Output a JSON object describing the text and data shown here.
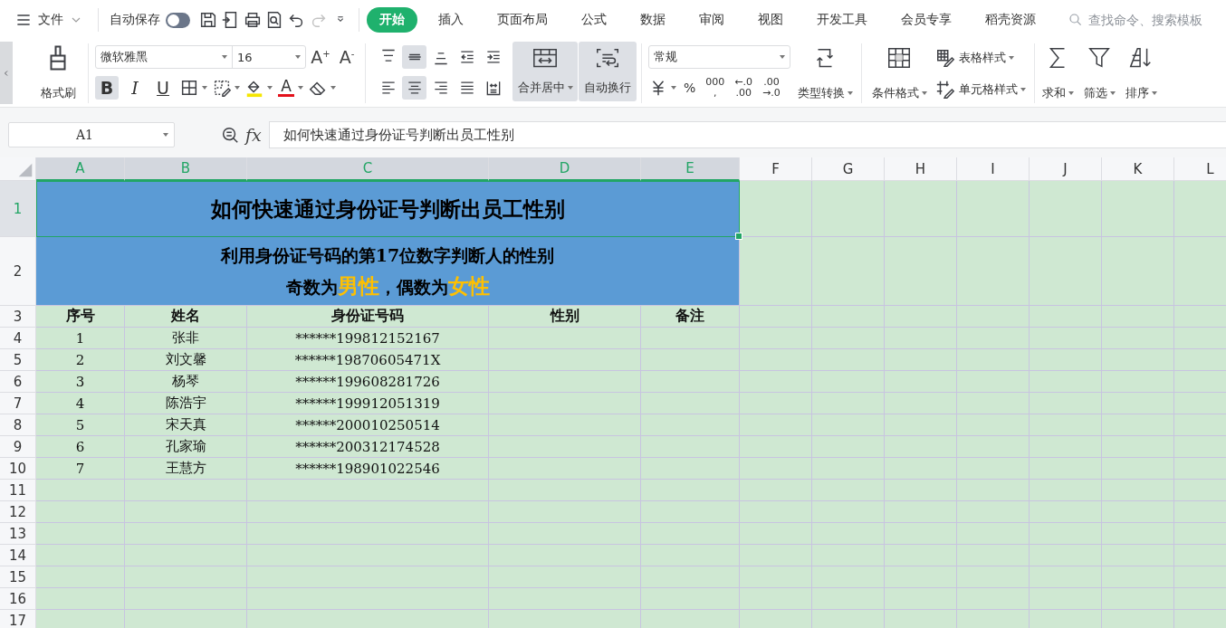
{
  "menu_bar": {
    "file_menu": "文件",
    "autosave": {
      "label": "自动保存",
      "on": false
    },
    "quick_access": [
      {
        "kind": "save",
        "disabled": false
      },
      {
        "kind": "export",
        "disabled": false
      },
      {
        "kind": "print",
        "disabled": false
      },
      {
        "kind": "preview",
        "disabled": false
      },
      {
        "kind": "undo",
        "disabled": false
      },
      {
        "kind": "redo",
        "disabled": true
      },
      {
        "kind": "more",
        "disabled": false
      }
    ],
    "tabs": [
      {
        "label": "开始",
        "selected": true
      },
      {
        "label": "插入",
        "selected": false
      },
      {
        "label": "页面布局",
        "selected": false
      },
      {
        "label": "公式",
        "selected": false
      },
      {
        "label": "数据",
        "selected": false
      },
      {
        "label": "审阅",
        "selected": false
      },
      {
        "label": "视图",
        "selected": false
      },
      {
        "label": "开发工具",
        "selected": false
      },
      {
        "label": "会员专享",
        "selected": false
      },
      {
        "label": "稻壳资源",
        "selected": false
      }
    ],
    "search": {
      "placeholder": "查找命令、搜索模板"
    }
  },
  "ribbon": {
    "format_painter": "格式刷",
    "font": {
      "name": "微软雅黑",
      "size": "16",
      "size_buttons": [
        "A$^{+}$",
        "A$^{-}$"
      ]
    },
    "font_styles": [
      {
        "kind": "bold",
        "label": "B",
        "selected": true
      },
      {
        "kind": "italic",
        "label": "I",
        "selected": false
      },
      {
        "kind": "underline",
        "label": "U",
        "selected": false
      }
    ],
    "font_tools": [
      {
        "kind": "borders"
      },
      {
        "kind": "cell-format"
      },
      {
        "kind": "fill-color"
      },
      {
        "kind": "font-color",
        "label": "A"
      },
      {
        "kind": "clear"
      }
    ],
    "align_rows": [
      [
        {
          "kind": "top",
          "selected": false
        },
        {
          "kind": "middle",
          "selected": true
        },
        {
          "kind": "bottom",
          "selected": false
        },
        {
          "kind": "outdent",
          "selected": false
        },
        {
          "kind": "indent",
          "selected": false
        }
      ],
      [
        {
          "kind": "left",
          "selected": false
        },
        {
          "kind": "center",
          "selected": true
        },
        {
          "kind": "right",
          "selected": false
        },
        {
          "kind": "justify",
          "selected": false
        },
        {
          "kind": "distributed",
          "selected": false
        }
      ]
    ],
    "merge": {
      "label": "合并居中",
      "selected": true
    },
    "wrap": {
      "label": "自动换行",
      "selected": true
    },
    "number_format": "常规",
    "number_tools": [
      {
        "kind": "currency"
      },
      {
        "kind": "text",
        "lines": [
          "%"
        ]
      },
      {
        "kind": "text",
        "lines": [
          "000",
          ","
        ]
      },
      {
        "kind": "text",
        "lines": [
          "←.0",
          ".00"
        ]
      },
      {
        "kind": "text",
        "lines": [
          ".00",
          "→.0"
        ]
      }
    ],
    "convert": "类型转换",
    "conditional_format": "条件格式",
    "table_style": "表格样式",
    "cell_style": "单元格样式",
    "editing": [
      {
        "kind": "sum",
        "label": "求和"
      },
      {
        "kind": "filter",
        "label": "筛选"
      },
      {
        "kind": "sort",
        "label": "排序"
      }
    ]
  },
  "formula_bar": {
    "name_box": "A1",
    "fx": "fx",
    "formula": "如何快速通过身份证号判断出员工性别"
  },
  "sheet": {
    "columns": [
      {
        "label": "A",
        "selected": true
      },
      {
        "label": "B",
        "selected": true
      },
      {
        "label": "C",
        "selected": true
      },
      {
        "label": "D",
        "selected": true
      },
      {
        "label": "E",
        "selected": true
      },
      {
        "label": "F",
        "selected": false
      },
      {
        "label": "G",
        "selected": false
      },
      {
        "label": "H",
        "selected": false
      },
      {
        "label": "I",
        "selected": false
      },
      {
        "label": "J",
        "selected": false
      },
      {
        "label": "K",
        "selected": false
      },
      {
        "label": "L",
        "selected": false
      }
    ],
    "rows": [
      {
        "label": "1",
        "selected": true
      },
      {
        "label": "2",
        "selected": false
      },
      {
        "label": "3",
        "selected": false
      },
      {
        "label": "4",
        "selected": false
      },
      {
        "label": "5",
        "selected": false
      },
      {
        "label": "6",
        "selected": false
      },
      {
        "label": "7",
        "selected": false
      },
      {
        "label": "8",
        "selected": false
      },
      {
        "label": "9",
        "selected": false
      },
      {
        "label": "10",
        "selected": false
      },
      {
        "label": "11",
        "selected": false
      },
      {
        "label": "12",
        "selected": false
      },
      {
        "label": "13",
        "selected": false
      },
      {
        "label": "14",
        "selected": false
      },
      {
        "label": "15",
        "selected": false
      },
      {
        "label": "16",
        "selected": false
      },
      {
        "label": "17",
        "selected": false
      }
    ],
    "title": "如何快速通过身份证号判断出员工性别",
    "subtitle": [
      "利用身份证号码的第17位数字判断人的性别",
      "奇数为**男性**，偶数为**女性**"
    ],
    "table": {
      "columns": [
        "序号",
        "姓名",
        "身份证号码",
        "性别",
        "备注"
      ],
      "rows": [
        [
          "1",
          "张非",
          "******199812152167"
        ],
        [
          "2",
          "刘文馨",
          "******19870605471X"
        ],
        [
          "3",
          "杨琴",
          "******199608281726"
        ],
        [
          "4",
          "陈浩宇",
          "******199912051319"
        ],
        [
          "5",
          "宋天真",
          "******200010250514"
        ],
        [
          "6",
          "孔家瑜",
          "******200312174528"
        ],
        [
          "7",
          "王慧方",
          "******198901022546"
        ]
      ]
    }
  }
}
